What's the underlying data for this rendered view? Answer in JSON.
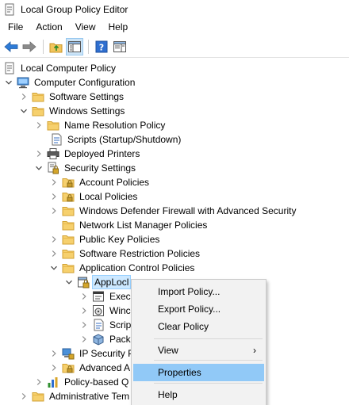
{
  "window": {
    "title": "Local Group Policy Editor"
  },
  "menu": [
    {
      "label": "File"
    },
    {
      "label": "Action"
    },
    {
      "label": "View"
    },
    {
      "label": "Help"
    }
  ],
  "toolbar": [
    {
      "icon": "back-arrow-icon"
    },
    {
      "icon": "forward-arrow-icon"
    },
    {
      "icon": "up-folder-icon"
    },
    {
      "icon": "show-hide-tree-icon"
    },
    {
      "icon": "help-icon"
    },
    {
      "icon": "properties-pane-icon"
    }
  ],
  "tree": {
    "items": [
      {
        "label": "Local Computer Policy",
        "icon": "policy-document-icon",
        "chevron": "none"
      },
      {
        "label": "Computer Configuration",
        "icon": "computer-icon",
        "chevron": "down"
      },
      {
        "label": "Software Settings",
        "icon": "folder-icon",
        "chevron": "right"
      },
      {
        "label": "Windows Settings",
        "icon": "folder-icon",
        "chevron": "down"
      },
      {
        "label": "Name Resolution Policy",
        "icon": "folder-icon",
        "chevron": "right"
      },
      {
        "label": "Scripts (Startup/Shutdown)",
        "icon": "script-icon",
        "chevron": "none"
      },
      {
        "label": "Deployed Printers",
        "icon": "printer-icon",
        "chevron": "right"
      },
      {
        "label": "Security Settings",
        "icon": "security-settings-icon",
        "chevron": "down"
      },
      {
        "label": "Account Policies",
        "icon": "locked-folder-icon",
        "chevron": "right"
      },
      {
        "label": "Local Policies",
        "icon": "locked-folder-icon",
        "chevron": "right"
      },
      {
        "label": "Windows Defender Firewall with Advanced Security",
        "icon": "folder-icon",
        "chevron": "right"
      },
      {
        "label": "Network List Manager Policies",
        "icon": "folder-icon",
        "chevron": "none"
      },
      {
        "label": "Public Key Policies",
        "icon": "folder-icon",
        "chevron": "right"
      },
      {
        "label": "Software Restriction Policies",
        "icon": "folder-icon",
        "chevron": "right"
      },
      {
        "label": "Application Control Policies",
        "icon": "folder-icon",
        "chevron": "down"
      },
      {
        "label": "AppLocl",
        "icon": "applocker-icon",
        "chevron": "down",
        "selected": true
      },
      {
        "label": "Exec",
        "icon": "rules-window-icon",
        "chevron": "right"
      },
      {
        "label": "Winc",
        "icon": "installer-icon",
        "chevron": "right"
      },
      {
        "label": "Scrip",
        "icon": "script-icon",
        "chevron": "right"
      },
      {
        "label": "Pack",
        "icon": "package-icon",
        "chevron": "right"
      },
      {
        "label": "IP Security P",
        "icon": "ip-security-icon",
        "chevron": "right"
      },
      {
        "label": "Advanced A",
        "icon": "locked-folder-icon",
        "chevron": "right"
      },
      {
        "label": "Policy-based Q",
        "icon": "chart-bars-icon",
        "chevron": "right"
      },
      {
        "label": "Administrative Tem",
        "icon": "folder-icon",
        "chevron": "right"
      }
    ]
  },
  "context_menu": {
    "items": [
      {
        "label": "Import Policy..."
      },
      {
        "label": "Export Policy..."
      },
      {
        "label": "Clear Policy"
      },
      {
        "label": "View",
        "submenu_arrow": "›"
      },
      {
        "label": "Properties",
        "highlighted": true
      },
      {
        "label": "Help"
      }
    ]
  }
}
